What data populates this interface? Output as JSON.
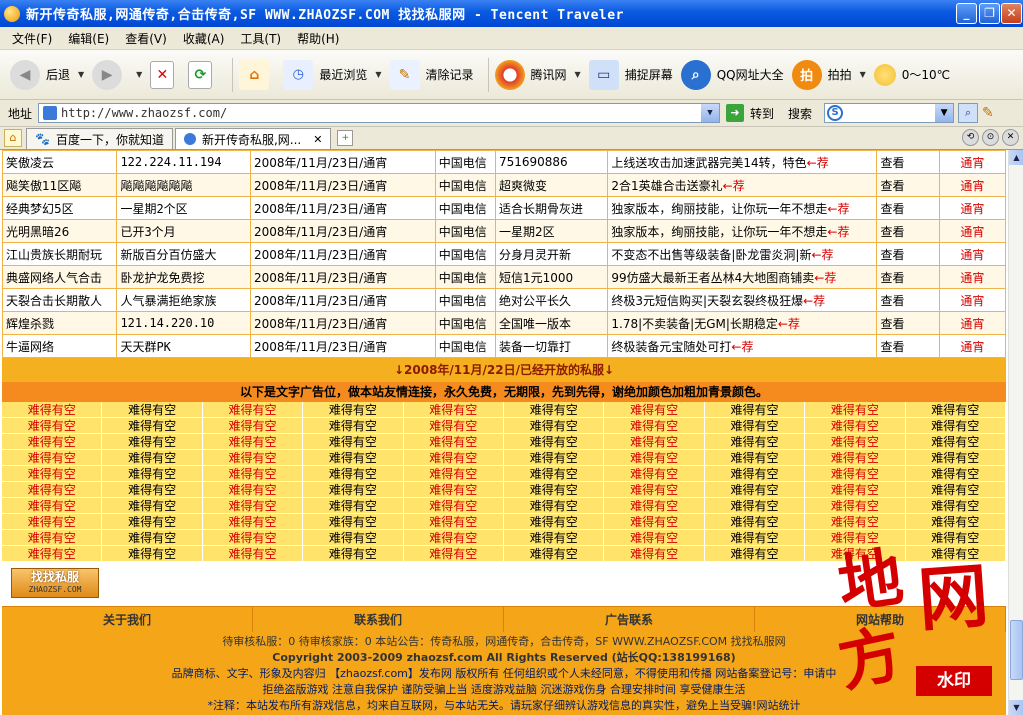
{
  "window": {
    "title": "新开传奇私服,网通传奇,合击传奇,SF WWW.ZHAOZSF.COM 找找私服网 - Tencent Traveler"
  },
  "menu": [
    "文件(F)",
    "编辑(E)",
    "查看(V)",
    "收藏(A)",
    "工具(T)",
    "帮助(H)"
  ],
  "toolbar": {
    "back": "后退",
    "recent": "最近浏览",
    "clear": "清除记录",
    "tencent": "腾讯网",
    "capture": "捕捉屏幕",
    "qq_sites": "QQ网址大全",
    "paipai": "拍拍",
    "weather": "0～10℃"
  },
  "address": {
    "label": "地址",
    "url": "http://www.zhaozsf.com/",
    "go": "转到",
    "search": "搜索"
  },
  "tabs": [
    "百度一下，你就知道",
    "新开传奇私服,网..."
  ],
  "servers": [
    {
      "name": "笑傲凌云",
      "ip": "122.224.11.194",
      "date": "2008年/11月/23日/通宵",
      "line": "中国电信",
      "version": "751690886",
      "desc": "上线送攻击加速武器完美14转，特色",
      "check": "查看",
      "type": "通宵"
    },
    {
      "name": "飚笑傲11区飚",
      "ip": "飚飚飚飚飚飚",
      "date": "2008年/11月/23日/通宵",
      "line": "中国电信",
      "version": "超爽微变",
      "desc": "2合1英雄合击送豪礼",
      "check": "查看",
      "type": "通宵"
    },
    {
      "name": "经典梦幻5区",
      "ip": "一星期2个区",
      "date": "2008年/11月/23日/通宵",
      "line": "中国电信",
      "version": "适合长期骨灰进",
      "desc": "独家版本，绚丽技能，让你玩一年不想走",
      "check": "查看",
      "type": "通宵"
    },
    {
      "name": "光明黑暗26",
      "ip": "已开3个月",
      "date": "2008年/11月/23日/通宵",
      "line": "中国电信",
      "version": "一星期2区",
      "desc": "独家版本，绚丽技能，让你玩一年不想走",
      "check": "查看",
      "type": "通宵"
    },
    {
      "name": "江山贵族长期耐玩",
      "ip": "新版百分百仿盛大",
      "date": "2008年/11月/23日/通宵",
      "line": "中国电信",
      "version": "分身月灵开新",
      "desc": "不变态不出售等级装备|卧龙雷炎洞|新",
      "check": "查看",
      "type": "通宵"
    },
    {
      "name": "典盛网络人气合击",
      "ip": "卧龙护龙免费挖",
      "date": "2008年/11月/23日/通宵",
      "line": "中国电信",
      "version": "短信1元1000",
      "desc": "99仿盛大最新王者丛林4大地图商铺卖",
      "check": "查看",
      "type": "通宵"
    },
    {
      "name": "天裂合击长期散人",
      "ip": "人气暴满拒绝家族",
      "date": "2008年/11月/23日/通宵",
      "line": "中国电信",
      "version": "绝对公平长久",
      "desc": "终极3元短信购买|天裂玄裂终极狂爆",
      "check": "查看",
      "type": "通宵"
    },
    {
      "name": "辉煌杀戮",
      "ip": "121.14.220.10",
      "date": "2008年/11月/23日/通宵",
      "line": "中国电信",
      "version": "全国唯一版本",
      "desc": "1.78|不卖装备|无GM|长期稳定",
      "check": "查看",
      "type": "通宵"
    },
    {
      "name": "牛逼网络",
      "ip": "天天群PK",
      "date": "2008年/11月/23日/通宵",
      "line": "中国电信",
      "version": "装备一切靠打",
      "desc": "终极装备元宝随处可打",
      "check": "查看",
      "type": "通宵"
    }
  ],
  "recommend": "←荐",
  "open_bar": "↓2008年/11月/22日/已经开放的私服↓",
  "ad_note": "以下是文字广告位，做本站友情连接，永久免费，无期限，先到先得，谢绝加颜色加粗加青景颜色。",
  "ad_text": "难得有空",
  "logo": {
    "title": "找找私服",
    "sub": "ZHAOZSF.COM"
  },
  "footnav": [
    "关于我们",
    "联系我们",
    "广告联系",
    "网站帮助"
  ],
  "footer": {
    "line1": "待审核私服：0  待审核家族：0  本站公告：传奇私服，网通传奇，合击传奇，SF WWW.ZHAOZSF.COM 找找私服网",
    "line2": "Copyright 2003-2009 zhaozsf.com All Rights Reserved (站长QQ:138199168)",
    "line3": "品牌商标、文字、形象及内容归 【zhaozsf.com】发布网 版权所有  任何组织或个人未经同意，不得使用和传播  网站备案登记号：申请中",
    "line4": "拒绝盗版游戏 注意自我保护 谨防受骗上当 适度游戏益脑 沉迷游戏伤身 合理安排时间 享受健康生活",
    "line5": "*注释：本站发布所有游戏信息，均来自互联网，与本站无关。请玩家仔细辨认游戏信息的真实性，避免上当受骗!网站统计"
  },
  "watermark": {
    "chars": [
      "地",
      "网",
      "方"
    ],
    "box": "水印"
  }
}
